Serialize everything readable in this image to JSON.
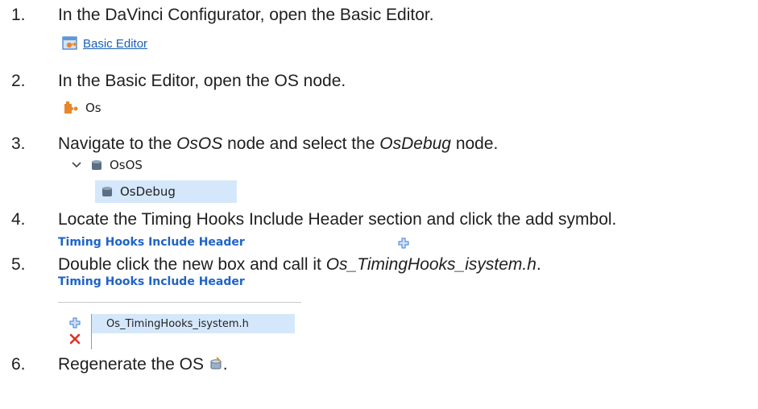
{
  "steps": [
    {
      "number": "1.",
      "parts": [
        {
          "t": "In the DaVinci Configurator, open the Basic Editor.",
          "i": false
        }
      ]
    },
    {
      "number": "2.",
      "parts": [
        {
          "t": "In the Basic Editor, open the OS node.",
          "i": false
        }
      ]
    },
    {
      "number": "3.",
      "parts": [
        {
          "t": "Navigate to the ",
          "i": false
        },
        {
          "t": "OsOS",
          "i": true
        },
        {
          "t": " node and select the ",
          "i": false
        },
        {
          "t": "OsDebug",
          "i": true
        },
        {
          "t": " node.",
          "i": false
        }
      ]
    },
    {
      "number": "4.",
      "parts": [
        {
          "t": "Locate the Timing Hooks Include Header section and click the add symbol.",
          "i": false
        }
      ]
    },
    {
      "number": "5.",
      "parts": [
        {
          "t": "Double click the new box and call it ",
          "i": false
        },
        {
          "t": "Os_TimingHooks_isystem.h",
          "i": true
        },
        {
          "t": ".",
          "i": false
        }
      ]
    },
    {
      "number": "6.",
      "parts": [
        {
          "t": "Regenerate the OS ",
          "i": false
        },
        {
          "t": ".",
          "i": false
        }
      ]
    }
  ],
  "basic_editor_link": "Basic Editor",
  "os_node_label": "Os",
  "tree": {
    "parent": "OsOS",
    "child": "OsDebug"
  },
  "timing_hooks_header": "Timing Hooks Include Header",
  "timing_hooks_header_2": "Timing Hooks Include Header",
  "new_entry_value": "Os_TimingHooks_isystem.h",
  "icons": {
    "basic_editor": "basic-editor-icon",
    "os_node": "os-module-icon",
    "expand": "chevron-down-icon",
    "container": "container-cylinder-icon",
    "add": "add-plus-icon",
    "delete": "delete-x-icon",
    "generate": "generate-icon"
  },
  "colors": {
    "link": "#1a5fb4",
    "header": "#1f63c6",
    "selection": "#d5e8fb",
    "add": "#3b7bd8",
    "delete": "#d9352a",
    "icon_orange": "#e8862a"
  }
}
